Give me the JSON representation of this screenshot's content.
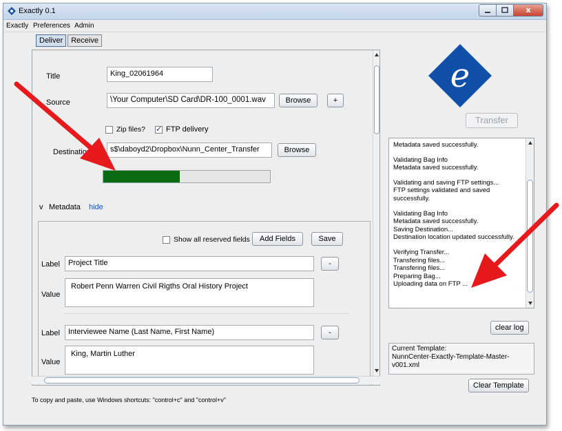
{
  "window": {
    "title": "Exactly 0.1",
    "close_glyph": "x"
  },
  "menu": [
    "Exactly",
    "Preferences",
    "Admin"
  ],
  "tabs": [
    {
      "label": "Deliver",
      "active": true
    },
    {
      "label": "Receive",
      "active": false
    }
  ],
  "form": {
    "title_label": "Title",
    "title_value": "King_02061964",
    "source_label": "Source",
    "source_value": "\\Your Computer\\SD Card\\DR-100_0001.wav",
    "browse_label": "Browse",
    "plus_label": "+",
    "zip_label": "Zip files?",
    "zip_checked": false,
    "ftp_label": "FTP delivery",
    "ftp_checked": true,
    "destination_label": "Destination",
    "destination_value": "s$\\daboyd2\\Dropbox\\Nunn_Center_Transfer",
    "dest_browse_label": "Browse",
    "progress_fraction": 0.46,
    "progress_color": "#0b6b12"
  },
  "metadata": {
    "toggle": "v",
    "label": "Metadata",
    "hide_link": "hide",
    "show_reserved_label": "Show all reserved fields",
    "add_fields_label": "Add Fields",
    "save_label": "Save",
    "entries": [
      {
        "label_caption": "Label",
        "label": "Project Title",
        "value_caption": "Value",
        "value": "Robert Penn Warren Civil Rigths Oral History Project",
        "remove": "-"
      },
      {
        "label_caption": "Label",
        "label": "Interviewee Name (Last Name, First Name)",
        "value_caption": "Value",
        "value": "King, Martin Luther",
        "remove": "-"
      }
    ]
  },
  "footer_hint": "To copy and paste, use Windows shortcuts: \"control+c\" and \"control+v\"",
  "logo": {
    "letter": "e",
    "color": "#0f4fa8"
  },
  "transfer_label": "Transfer",
  "log": [
    "Metadata saved successfully.",
    "",
    "Validating Bag Info",
    "Metadata saved successfully.",
    "",
    "Validating and saving FTP settings...",
    "FTP settings validated and saved",
    "successfully.",
    "",
    "Validating Bag Info",
    "Metadata saved successfully.",
    "Saving Destination...",
    "Destination location updated successfully.",
    "",
    "Verifying Transfer...",
    "Transfering files...",
    "Transfering files...",
    "Preparing Bag...",
    "Uploading data on FTP ..."
  ],
  "clear_log_label": "clear log",
  "template": {
    "heading": "Current Template:",
    "line1": "NunnCenter-Exactly-Template-Master-",
    "line2": "v001.xml"
  },
  "clear_template_label": "Clear Template",
  "annotation_color": "#e8191c"
}
